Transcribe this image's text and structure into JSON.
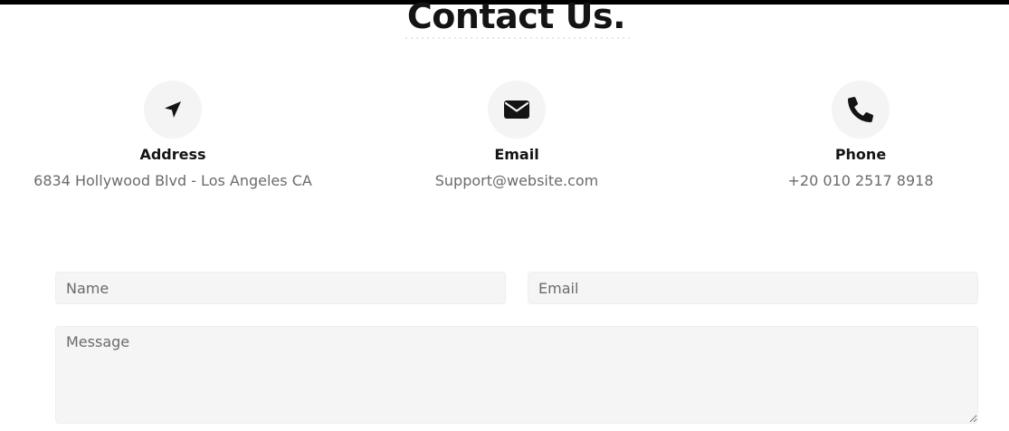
{
  "header": {
    "title": "Contact Us."
  },
  "contact_info": [
    {
      "icon": "location-arrow-icon",
      "label": "Address",
      "value": "6834 Hollywood Blvd - Los Angeles CA"
    },
    {
      "icon": "envelope-icon",
      "label": "Email",
      "value": "Support@website.com"
    },
    {
      "icon": "phone-icon",
      "label": "Phone",
      "value": "+20 010 2517 8918"
    }
  ],
  "form": {
    "name_placeholder": "Name",
    "email_placeholder": "Email",
    "message_placeholder": "Message"
  },
  "colors": {
    "title": "#141414",
    "label": "#141414",
    "value": "#6b6b6b",
    "icon_bg": "#f4f4f4",
    "field_bg": "#f5f5f5",
    "top_bar": "#000000"
  }
}
